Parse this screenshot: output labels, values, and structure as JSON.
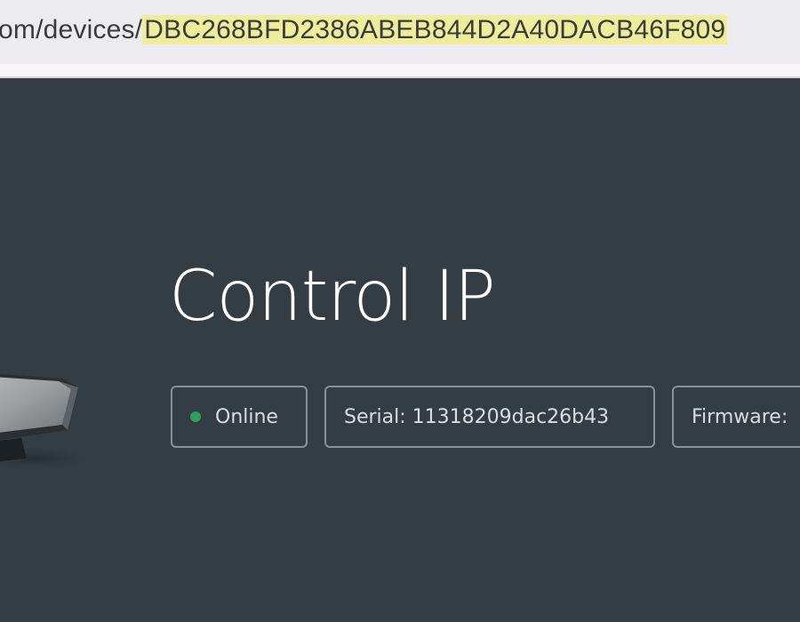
{
  "browser": {
    "url_prefix": "om/devices/",
    "url_highlighted": "DBC268BFD2386ABEB844D2A40DACB46F809"
  },
  "device": {
    "name": "Control IP",
    "status": "Online",
    "status_color": "#2e9e5b",
    "serial": "Serial: 11318209dac26b43",
    "firmware": "Firmware:"
  },
  "colors": {
    "background": "#343d44",
    "url_highlight": "#eeee9a",
    "chip_border": "#8a9197"
  }
}
